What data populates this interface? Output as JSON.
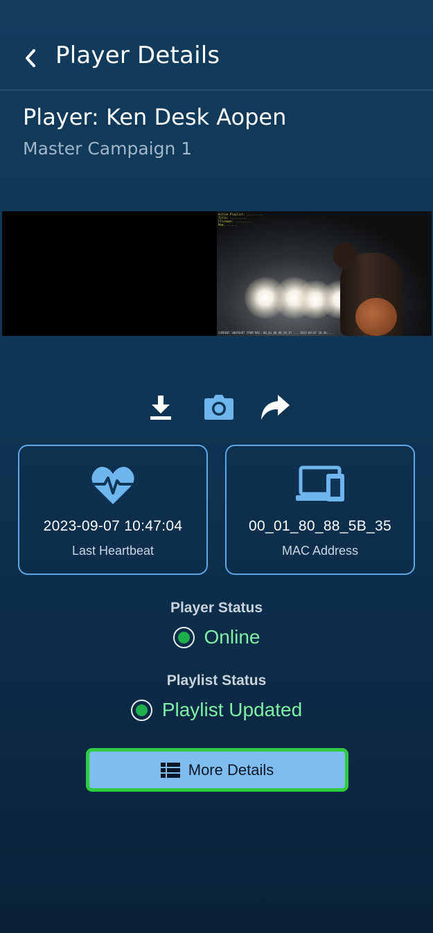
{
  "header": {
    "title": "Player Details",
    "back_icon": "chevron-left-icon"
  },
  "player": {
    "name": "Player: Ken Desk Aopen",
    "campaign": "Master Campaign 1"
  },
  "preview": {
    "osd_lines": [
      "Active Playlist: ..........",
      "Title: ..........",
      "Filename: ..........",
      "Mem: ......"
    ],
    "osd_footer": "CURRENT SNAPSHOT FROM MAC: 00_01_80_88_5B_35 ... 2023-09-07 10:46:..."
  },
  "actions": [
    {
      "name": "download-icon"
    },
    {
      "name": "camera-icon"
    },
    {
      "name": "share-icon"
    }
  ],
  "cards": {
    "heartbeat": {
      "value": "2023-09-07 10:47:04",
      "label": "Last Heartbeat",
      "icon": "heartbeat-icon"
    },
    "mac": {
      "value": "00_01_80_88_5B_35",
      "label": "MAC Address",
      "icon": "devices-icon"
    }
  },
  "player_status": {
    "label": "Player Status",
    "value": "Online"
  },
  "playlist_status": {
    "label": "Playlist Status",
    "value": "Playlist Updated"
  },
  "more_button": {
    "label": "More Details",
    "icon": "list-icon"
  },
  "colors": {
    "accent_blue": "#5ea7e6",
    "status_green": "#7ff0a6",
    "button_fill": "#7fbcf0",
    "button_border": "#2ecc40"
  }
}
